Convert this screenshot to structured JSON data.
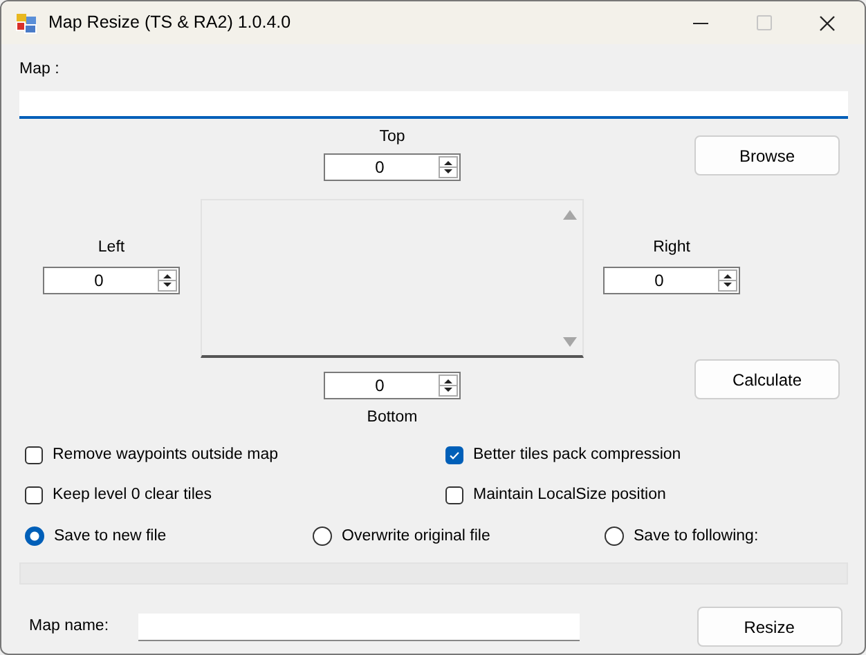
{
  "window": {
    "title": "Map Resize (TS & RA2) 1.0.4.0"
  },
  "title_buttons": [
    {
      "kind": "minimize",
      "disabled": false
    },
    {
      "kind": "maximize",
      "disabled": true
    },
    {
      "kind": "close",
      "disabled": false
    }
  ],
  "map": {
    "label": "Map :"
  },
  "offsets": {
    "top": {
      "label": "Top",
      "value": "0"
    },
    "left": {
      "label": "Left",
      "value": "0"
    },
    "right": {
      "label": "Right",
      "value": "0"
    },
    "bottom": {
      "label": "Bottom",
      "value": "0"
    }
  },
  "browse_button": "Browse",
  "calculate_button": "Calculate",
  "options": [
    {
      "label": "Remove waypoints outside map",
      "checked": false
    },
    {
      "label": "Better tiles pack compression",
      "checked": true
    },
    {
      "label": "Keep level 0 clear tiles",
      "checked": false
    },
    {
      "label": "Maintain LocalSize position",
      "checked": false
    }
  ],
  "save_modes": [
    {
      "label": "Save to new file",
      "selected": true
    },
    {
      "label": "Overwrite original file",
      "selected": false
    },
    {
      "label": "Save to following:",
      "selected": false
    }
  ],
  "progress": {
    "level": 0
  },
  "map_name": {
    "label": "Map name:"
  },
  "resize_button": "Resize"
}
